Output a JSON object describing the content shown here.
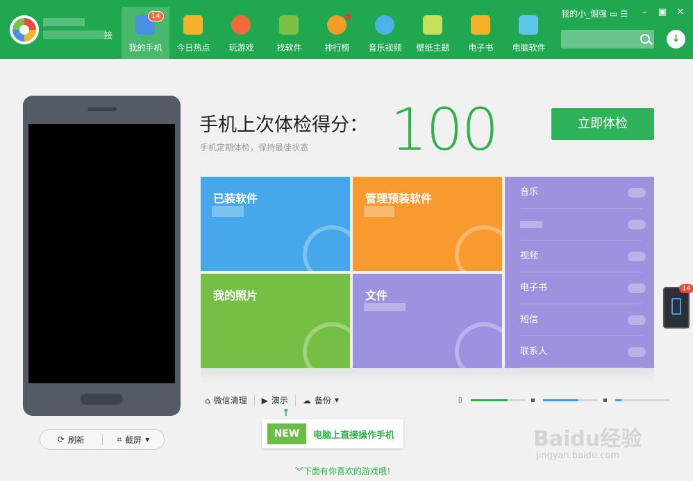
{
  "app": {
    "account_suffix": "接",
    "user_name": "我的小_倔强"
  },
  "nav": {
    "items": [
      {
        "label": "我的手机",
        "icon": "phone-icon",
        "color": "#4a90e2"
      },
      {
        "label": "今日热点",
        "icon": "star-folder-icon",
        "color": "#f7b22b"
      },
      {
        "label": "玩游戏",
        "icon": "gamepad-icon",
        "color": "#f36b3a"
      },
      {
        "label": "找软件",
        "icon": "android-icon",
        "color": "#7cc142"
      },
      {
        "label": "排行榜",
        "icon": "medal-icon",
        "color": "#f39c2b"
      },
      {
        "label": "音乐视频",
        "icon": "play-icon",
        "color": "#4ab4e8"
      },
      {
        "label": "壁纸主题",
        "icon": "wallpaper-icon",
        "color": "#c5e05a"
      },
      {
        "label": "电子书",
        "icon": "book-icon",
        "color": "#f7b22b"
      },
      {
        "label": "电脑软件",
        "icon": "windows-icon",
        "color": "#5ec6e8"
      }
    ],
    "badge": "14"
  },
  "search": {
    "placeholder": ""
  },
  "score": {
    "title": "手机上次体检得分：",
    "subtitle": "手机定期体检，保持最佳状态",
    "value": "100",
    "check_button": "立即体检"
  },
  "tiles": {
    "installed": "已装软件",
    "preinstalled": "管理预装软件",
    "photos": "我的照片",
    "files": "文件",
    "list": [
      "音乐",
      "",
      "视频",
      "电子书",
      "短信",
      "联系人"
    ]
  },
  "phone_actions": {
    "refresh": "刷新",
    "screenshot": "截屏"
  },
  "tools": {
    "wechat_clean": "微信清理",
    "demo": "演示",
    "backup": "备份"
  },
  "storage": [
    {
      "fill": 0.68,
      "color": "#2eb34a"
    },
    {
      "fill": 0.65,
      "color": "#39a2e8"
    },
    {
      "fill": 0.12,
      "color": "#39a2e8"
    }
  ],
  "promo": {
    "new": "NEW",
    "text": "电脑上直接操作手机"
  },
  "more_games": "下面有你喜欢的游戏哦！",
  "side_widget": {
    "badge": "14"
  },
  "watermark": {
    "text": "Baidu经验",
    "sub": "jingyan.baidu.com"
  }
}
